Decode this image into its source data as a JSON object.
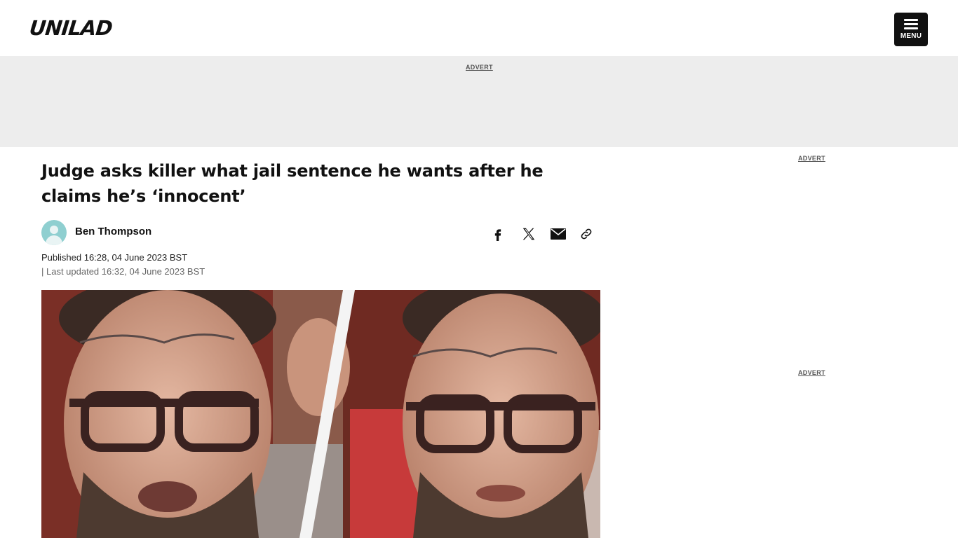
{
  "header": {
    "logo_text": "UNILAD",
    "menu_label": "MENU"
  },
  "adverts": {
    "top_label": "ADVERT",
    "sidebar_label_1": "ADVERT",
    "sidebar_label_2": "ADVERT"
  },
  "article": {
    "headline": "Judge asks killer what jail sentence he wants after he claims he’s ‘innocent’",
    "author": "Ben Thompson",
    "published": "Published 16:28, 04 June 2023 BST",
    "updated": "| Last updated 16:32, 04 June 2023 BST"
  },
  "share_icons": [
    "facebook-icon",
    "x-icon",
    "email-icon",
    "link-icon"
  ],
  "colors": {
    "brand_black": "#111111",
    "ad_band": "#ededed",
    "avatar": "#8fcfd0"
  }
}
